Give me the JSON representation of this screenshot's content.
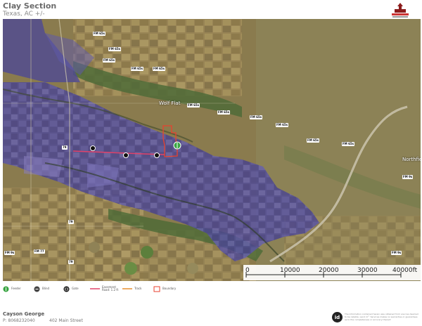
{
  "header": {
    "title": "Clay Section",
    "subtitle": "Texas, AC +/-"
  },
  "map": {
    "roads": [
      "FM 65s",
      "FM 65s",
      "FM 65s",
      "FM 65s",
      "FM 65s",
      "FM 65s",
      "FM 65s",
      "FM 65s",
      "FM 65s",
      "FM 65s",
      "FM 65s",
      "FM 77",
      "FM 9s",
      "FM 9s",
      "FM 9s",
      "79",
      "79",
      "79"
    ],
    "places": [
      "Wolf Flat",
      "Northfield"
    ],
    "colors": {
      "water_features": "#4fd0e8",
      "boundary": "#e8422f",
      "easement": "#e0426a",
      "property_overlay": "#5b56b8"
    }
  },
  "scale": {
    "labels": [
      "0",
      "10000",
      "20000",
      "30000",
      "40000ft"
    ]
  },
  "legend": {
    "items": [
      {
        "label": "Feeder",
        "icon": "feeder-icon"
      },
      {
        "label": "Blind",
        "icon": "blind-icon"
      },
      {
        "label": "Gate",
        "icon": "gate-icon"
      },
      {
        "label": "Easement\nRoad: 1.2 ft",
        "icon": "easement-line-icon"
      },
      {
        "label": "Track",
        "icon": "track-line-icon"
      },
      {
        "label": "Boundary",
        "icon": "boundary-icon"
      }
    ]
  },
  "footer": {
    "name": "Cayson George",
    "phone": "P: 8068232040",
    "address": "402 Main Street",
    "id_badge": "id",
    "disclaimer": "The information contained herein was obtained from sources deemed to be reliable. Land id™ Services makes no warranties or guarantees as to the completeness or accuracy thereof."
  }
}
